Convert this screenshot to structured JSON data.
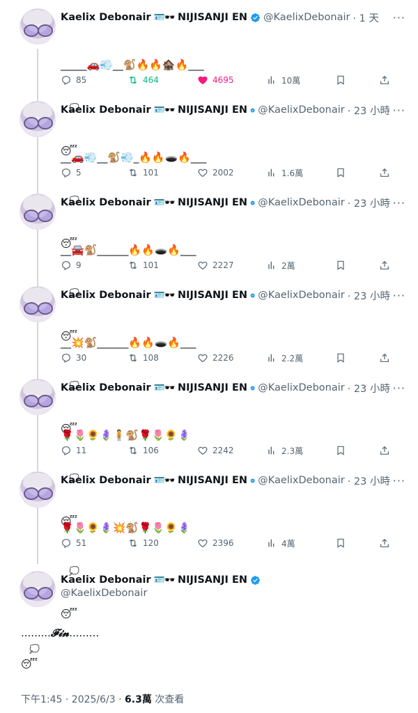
{
  "author": {
    "name": "Kaelix Debonair",
    "badge_emoji": "🪪🕶️",
    "affiliation": "NIJISANJI EN",
    "handle": "@KaelixDebonair"
  },
  "tweets": [
    {
      "time": "· 1 天",
      "line1": "_____🚗💨__🐒🔥🔥🏚️🔥___",
      "thought": "💭",
      "line3": "😴",
      "reply_count": "85",
      "retweet_count": "464",
      "like_count": "4695",
      "view_count": "10萬",
      "liked": true,
      "retweeted": true
    },
    {
      "time": "· 23 小時",
      "line1": "__🚗💨__🐒💨_🔥🔥🕳️🔥___",
      "thought": "💭",
      "line3": "😴",
      "reply_count": "5",
      "retweet_count": "101",
      "like_count": "2002",
      "view_count": "1.6萬"
    },
    {
      "time": "· 23 小時",
      "line1": "__🚘🐒______🔥🔥🕳️🔥___",
      "thought": "💭",
      "line3": "😴",
      "reply_count": "9",
      "retweet_count": "101",
      "like_count": "2227",
      "view_count": "2萬"
    },
    {
      "time": "· 23 小時",
      "line1": "__💥🐒______🔥🔥🕳️🔥___",
      "thought": "💭",
      "line3": "😴",
      "reply_count": "30",
      "retweet_count": "108",
      "like_count": "2226",
      "view_count": "2.2萬"
    },
    {
      "time": "· 23 小時",
      "line1": "🌹🌷🌻🪻🧍🐒🌹🌷🌻🪻",
      "thought": "💭",
      "line3": "😴",
      "reply_count": "11",
      "retweet_count": "106",
      "like_count": "2242",
      "view_count": "2.3萬"
    },
    {
      "time": "· 23 小時",
      "line1": "🌹🌷🌻🪻💥🐒🌹🌷🌻🪻",
      "thought": "💭",
      "line3": "😴",
      "reply_count": "51",
      "retweet_count": "120",
      "like_count": "2396",
      "view_count": "4萬"
    }
  ],
  "final_post": {
    "fin_prefix": ".........",
    "fin_word": "𝓕𝓲𝓷",
    "fin_suffix": ".........",
    "thought": "💭",
    "sleep": "😴",
    "timestamp": "下午1:45 · 2025/6/3 · ",
    "views": "6.3萬",
    "views_label": " 次查看"
  },
  "colors": {
    "verified_blue": "#1d9bf0",
    "retweet_green": "#00ba7c",
    "like_pink": "#f91880",
    "muted_gray": "#536471"
  }
}
